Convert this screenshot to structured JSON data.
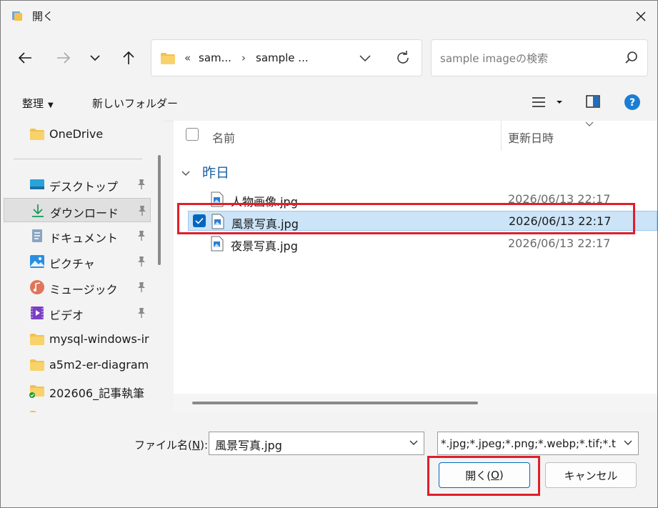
{
  "window": {
    "title": "開く"
  },
  "address": {
    "prefix": "«",
    "crumbs": [
      "sam...",
      "sample ..."
    ],
    "separator": "›"
  },
  "search": {
    "placeholder": "sample imageの検索"
  },
  "commandbar": {
    "organize": "整理",
    "new_folder": "新しいフォルダー"
  },
  "sidebar": {
    "items": [
      {
        "label": "OneDrive",
        "icon": "folder-icon",
        "pinned": false
      },
      {
        "label": "デスクトップ",
        "icon": "desktop-icon",
        "pinned": true
      },
      {
        "label": "ダウンロード",
        "icon": "download-icon",
        "pinned": true,
        "selected": true
      },
      {
        "label": "ドキュメント",
        "icon": "document-icon",
        "pinned": true
      },
      {
        "label": "ピクチャ",
        "icon": "pictures-icon",
        "pinned": true
      },
      {
        "label": "ミュージック",
        "icon": "music-icon",
        "pinned": true
      },
      {
        "label": "ビデオ",
        "icon": "video-icon",
        "pinned": true
      },
      {
        "label": "mysql-windows-ir",
        "icon": "folder-icon",
        "pinned": false
      },
      {
        "label": "a5m2-er-diagram",
        "icon": "folder-icon",
        "pinned": false
      },
      {
        "label": "202606_記事執筆",
        "icon": "folder-synced-icon",
        "pinned": false
      }
    ]
  },
  "filelist": {
    "columns": {
      "name": "名前",
      "date": "更新日時"
    },
    "group": "昨日",
    "files": [
      {
        "name": "人物画像.jpg",
        "date": "2026/06/13 22:17",
        "selected": false
      },
      {
        "name": "風景写真.jpg",
        "date": "2026/06/13 22:17",
        "selected": true
      },
      {
        "name": "夜景写真.jpg",
        "date": "2026/06/13 22:17",
        "selected": false
      }
    ]
  },
  "footer": {
    "filename_label": "ファイル名(",
    "filename_key": "N",
    "filename_label_end": "):",
    "filename_value": "風景写真.jpg",
    "filetype_value": "*.jpg;*.jpeg;*.png;*.webp;*.tif;*.t",
    "open_label": "開く(",
    "open_key": "O",
    "open_label_end": ")",
    "cancel_label": "キャンセル"
  },
  "colors": {
    "accent": "#0067c0",
    "highlight": "#e01e2a",
    "selection": "#cce4f7",
    "folder": "#f2c14e"
  }
}
